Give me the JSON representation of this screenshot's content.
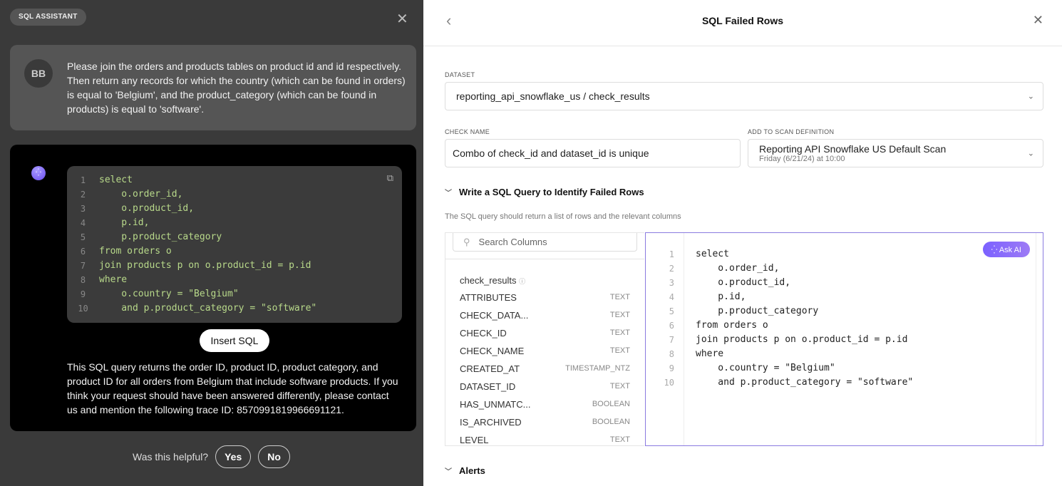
{
  "assistant": {
    "badge": "SQL ASSISTANT",
    "user_initials": "BB",
    "user_message": "Please join the orders and products tables on product id and id respectively. Then return any records for which the country (which can be found in orders) is equal to 'Belgium', and the product_category (which can be found in products) is equal to 'software'.",
    "code": [
      "select",
      "    o.order_id,",
      "    o.product_id,",
      "    p.id,",
      "    p.product_category",
      "from orders o",
      "join products p on o.product_id = p.id",
      "where",
      "    o.country = \"Belgium\"",
      "    and p.product_category = \"software\""
    ],
    "insert_label": "Insert SQL",
    "explanation": "This SQL query returns the order ID, product ID, product category, and product ID for all orders from Belgium that include software products. If you think your request should have been answered differently, please contact us and mention the following trace ID: 8570991819966691121.",
    "helpful_question": "Was this helpful?",
    "yes": "Yes",
    "no": "No"
  },
  "panel": {
    "title": "SQL Failed Rows",
    "dataset_label": "DATASET",
    "dataset_value": "reporting_api_snowflake_us / check_results",
    "check_name_label": "CHECK NAME",
    "check_name_value": "Combo of check_id and dataset_id is unique",
    "scan_label": "ADD TO SCAN DEFINITION",
    "scan_value": "Reporting API Snowflake US Default Scan",
    "scan_sub": "Friday (6/21/24) at 10:00",
    "section_title": "Write a SQL Query to Identify Failed Rows",
    "hint": "The SQL query should return a list of rows and the relevant columns",
    "search_placeholder": "Search Columns",
    "table_name": "check_results",
    "columns": [
      {
        "name": "ATTRIBUTES",
        "type": "TEXT"
      },
      {
        "name": "CHECK_DATA...",
        "type": "TEXT"
      },
      {
        "name": "CHECK_ID",
        "type": "TEXT"
      },
      {
        "name": "CHECK_NAME",
        "type": "TEXT"
      },
      {
        "name": "CREATED_AT",
        "type": "TIMESTAMP_NTZ"
      },
      {
        "name": "DATASET_ID",
        "type": "TEXT"
      },
      {
        "name": "HAS_UNMATC...",
        "type": "BOOLEAN"
      },
      {
        "name": "IS_ARCHIVED",
        "type": "BOOLEAN"
      },
      {
        "name": "LEVEL",
        "type": "TEXT"
      }
    ],
    "ask_ai": "Ask AI",
    "alerts_title": "Alerts"
  }
}
